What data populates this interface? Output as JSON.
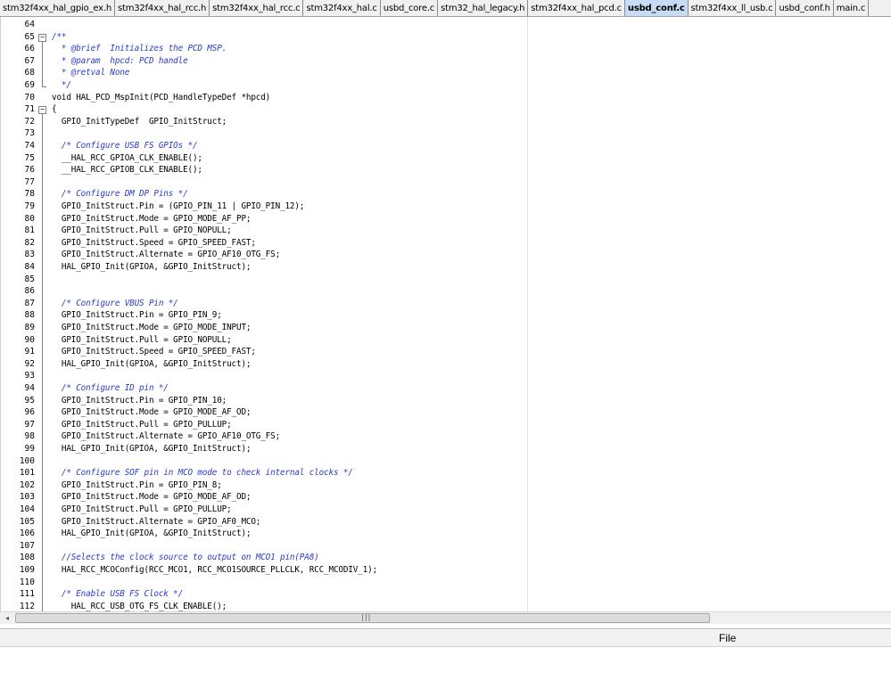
{
  "tabs": [
    {
      "label": "stm32f4xx_hal_gpio_ex.h",
      "active": false
    },
    {
      "label": "stm32f4xx_hal_rcc.h",
      "active": false
    },
    {
      "label": "stm32f4xx_hal_rcc.c",
      "active": false
    },
    {
      "label": "stm32f4xx_hal.c",
      "active": false
    },
    {
      "label": "usbd_core.c",
      "active": false
    },
    {
      "label": "stm32_hal_legacy.h",
      "active": false
    },
    {
      "label": "stm32f4xx_hal_pcd.c",
      "active": false
    },
    {
      "label": "usbd_conf.c",
      "active": true
    },
    {
      "label": "stm32f4xx_ll_usb.c",
      "active": false
    },
    {
      "label": "usbd_conf.h",
      "active": false
    },
    {
      "label": "main.c",
      "active": false
    }
  ],
  "editor": {
    "lines": [
      {
        "n": "64",
        "text": "",
        "type": "code"
      },
      {
        "n": "65",
        "text": "/**",
        "type": "comment",
        "fold": "open"
      },
      {
        "n": "66",
        "text": "  * @brief  Initializes the PCD MSP.",
        "type": "comment"
      },
      {
        "n": "67",
        "text": "  * @param  hpcd: PCD handle",
        "type": "comment"
      },
      {
        "n": "68",
        "text": "  * @retval None",
        "type": "comment"
      },
      {
        "n": "69",
        "text": "  */",
        "type": "comment",
        "fold": "end"
      },
      {
        "n": "70",
        "text": "void HAL_PCD_MspInit(PCD_HandleTypeDef *hpcd)",
        "type": "code"
      },
      {
        "n": "71",
        "text": "{",
        "type": "code",
        "fold": "open"
      },
      {
        "n": "72",
        "text": "  GPIO_InitTypeDef  GPIO_InitStruct;",
        "type": "code"
      },
      {
        "n": "73",
        "text": "",
        "type": "code"
      },
      {
        "n": "74",
        "text": "  /* Configure USB FS GPIOs */",
        "type": "comment"
      },
      {
        "n": "75",
        "text": "  __HAL_RCC_GPIOA_CLK_ENABLE();",
        "type": "code"
      },
      {
        "n": "76",
        "text": "  __HAL_RCC_GPIOB_CLK_ENABLE();",
        "type": "code"
      },
      {
        "n": "77",
        "text": "",
        "type": "code"
      },
      {
        "n": "78",
        "text": "  /* Configure DM DP Pins */",
        "type": "comment"
      },
      {
        "n": "79",
        "text": "  GPIO_InitStruct.Pin = (GPIO_PIN_11 | GPIO_PIN_12);",
        "type": "code"
      },
      {
        "n": "80",
        "text": "  GPIO_InitStruct.Mode = GPIO_MODE_AF_PP;",
        "type": "code"
      },
      {
        "n": "81",
        "text": "  GPIO_InitStruct.Pull = GPIO_NOPULL;",
        "type": "code"
      },
      {
        "n": "82",
        "text": "  GPIO_InitStruct.Speed = GPIO_SPEED_FAST;",
        "type": "code"
      },
      {
        "n": "83",
        "text": "  GPIO_InitStruct.Alternate = GPIO_AF10_OTG_FS;",
        "type": "code"
      },
      {
        "n": "84",
        "text": "  HAL_GPIO_Init(GPIOA, &GPIO_InitStruct);",
        "type": "code"
      },
      {
        "n": "85",
        "text": "",
        "type": "code"
      },
      {
        "n": "86",
        "text": "",
        "type": "code"
      },
      {
        "n": "87",
        "text": "  /* Configure VBUS Pin */",
        "type": "comment"
      },
      {
        "n": "88",
        "text": "  GPIO_InitStruct.Pin = GPIO_PIN_9;",
        "type": "code"
      },
      {
        "n": "89",
        "text": "  GPIO_InitStruct.Mode = GPIO_MODE_INPUT;",
        "type": "code"
      },
      {
        "n": "90",
        "text": "  GPIO_InitStruct.Pull = GPIO_NOPULL;",
        "type": "code"
      },
      {
        "n": "91",
        "text": "  GPIO_InitStruct.Speed = GPIO_SPEED_FAST;",
        "type": "code"
      },
      {
        "n": "92",
        "text": "  HAL_GPIO_Init(GPIOA, &GPIO_InitStruct);",
        "type": "code"
      },
      {
        "n": "93",
        "text": "",
        "type": "code"
      },
      {
        "n": "94",
        "text": "  /* Configure ID pin */",
        "type": "comment"
      },
      {
        "n": "95",
        "text": "  GPIO_InitStruct.Pin = GPIO_PIN_10;",
        "type": "code"
      },
      {
        "n": "96",
        "text": "  GPIO_InitStruct.Mode = GPIO_MODE_AF_OD;",
        "type": "code"
      },
      {
        "n": "97",
        "text": "  GPIO_InitStruct.Pull = GPIO_PULLUP;",
        "type": "code"
      },
      {
        "n": "98",
        "text": "  GPIO_InitStruct.Alternate = GPIO_AF10_OTG_FS;",
        "type": "code"
      },
      {
        "n": "99",
        "text": "  HAL_GPIO_Init(GPIOA, &GPIO_InitStruct);",
        "type": "code"
      },
      {
        "n": "100",
        "text": "",
        "type": "code"
      },
      {
        "n": "101",
        "text": "  /* Configure SOF pin in MCO mode to check internal clocks */",
        "type": "comment"
      },
      {
        "n": "102",
        "text": "  GPIO_InitStruct.Pin = GPIO_PIN_8;",
        "type": "code"
      },
      {
        "n": "103",
        "text": "  GPIO_InitStruct.Mode = GPIO_MODE_AF_OD;",
        "type": "code"
      },
      {
        "n": "104",
        "text": "  GPIO_InitStruct.Pull = GPIO_PULLUP;",
        "type": "code"
      },
      {
        "n": "105",
        "text": "  GPIO_InitStruct.Alternate = GPIO_AF0_MCO;",
        "type": "code"
      },
      {
        "n": "106",
        "text": "  HAL_GPIO_Init(GPIOA, &GPIO_InitStruct);",
        "type": "code"
      },
      {
        "n": "107",
        "text": "",
        "type": "code"
      },
      {
        "n": "108",
        "text": "  //Selects the clock source to output on MCO1 pin(PA8)",
        "type": "comment"
      },
      {
        "n": "109",
        "text": "  HAL_RCC_MCOConfig(RCC_MCO1, RCC_MCO1SOURCE_PLLCLK, RCC_MCODIV_1);",
        "type": "code"
      },
      {
        "n": "110",
        "text": "",
        "type": "code"
      },
      {
        "n": "111",
        "text": "  /* Enable USB FS Clock */",
        "type": "comment"
      },
      {
        "n": "112",
        "text": "    HAL_RCC_USB_OTG_FS_CLK_ENABLE();",
        "type": "code"
      }
    ]
  },
  "scrollbar": {
    "left_arrow": "◂",
    "grip": "|||"
  },
  "status": {
    "file_label": "File"
  },
  "colors": {
    "comment": "#2a3acb",
    "active_tab": "#c6dbf5"
  }
}
